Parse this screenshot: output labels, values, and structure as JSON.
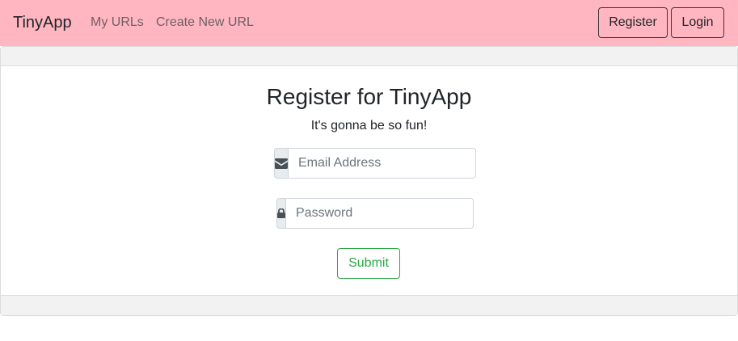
{
  "navbar": {
    "brand": "TinyApp",
    "links": [
      {
        "label": "My URLs"
      },
      {
        "label": "Create New URL"
      }
    ],
    "buttons": {
      "register": "Register",
      "login": "Login"
    },
    "background_color": "#ffb6c1"
  },
  "main": {
    "title": "Register for TinyApp",
    "subtitle": "It's gonna be so fun!",
    "email": {
      "placeholder": "Email Address",
      "value": "",
      "icon": "envelope-icon"
    },
    "password": {
      "placeholder": "Password",
      "value": "",
      "icon": "lock-icon"
    },
    "submit_label": "Submit",
    "submit_color": "#28a745"
  }
}
